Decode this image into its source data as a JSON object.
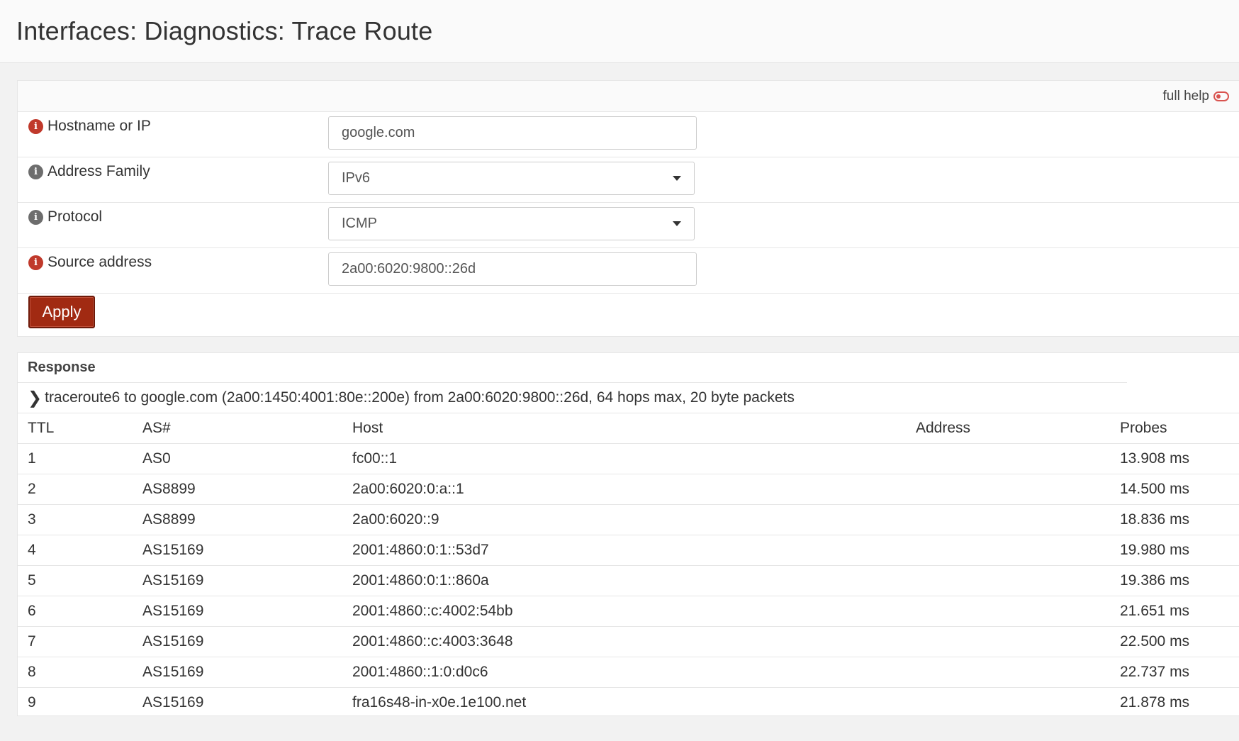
{
  "header": {
    "title": "Interfaces: Diagnostics: Trace Route"
  },
  "form": {
    "full_help_label": "full help",
    "fields": [
      {
        "label": "Hostname or IP",
        "value": "google.com",
        "info_color": "#c0392b"
      },
      {
        "label": "Address Family",
        "value": "IPv6",
        "info_color": "#6d6d6d"
      },
      {
        "label": "Protocol",
        "value": "ICMP",
        "info_color": "#6d6d6d"
      },
      {
        "label": "Source address",
        "value": "2a00:6020:9800::26d",
        "info_color": "#c0392b"
      }
    ],
    "apply_label": "Apply"
  },
  "response": {
    "title": "Response",
    "command": "traceroute6 to google.com (2a00:1450:4001:80e::200e) from 2a00:6020:9800::26d, 64 hops max, 20 byte packets",
    "columns": [
      "TTL",
      "AS#",
      "Host",
      "Address",
      "Probes"
    ],
    "rows": [
      {
        "ttl": "1",
        "as": "AS0",
        "host": "fc00::1",
        "address": "",
        "probes": "13.908 ms"
      },
      {
        "ttl": "2",
        "as": "AS8899",
        "host": "2a00:6020:0:a::1",
        "address": "",
        "probes": "14.500 ms"
      },
      {
        "ttl": "3",
        "as": "AS8899",
        "host": "2a00:6020::9",
        "address": "",
        "probes": "18.836 ms"
      },
      {
        "ttl": "4",
        "as": "AS15169",
        "host": "2001:4860:0:1::53d7",
        "address": "",
        "probes": "19.980 ms"
      },
      {
        "ttl": "5",
        "as": "AS15169",
        "host": "2001:4860:0:1::860a",
        "address": "",
        "probes": "19.386 ms"
      },
      {
        "ttl": "6",
        "as": "AS15169",
        "host": "2001:4860::c:4002:54bb",
        "address": "",
        "probes": "21.651 ms"
      },
      {
        "ttl": "7",
        "as": "AS15169",
        "host": "2001:4860::c:4003:3648",
        "address": "",
        "probes": "22.500 ms"
      },
      {
        "ttl": "8",
        "as": "AS15169",
        "host": "2001:4860::1:0:d0c6",
        "address": "",
        "probes": "22.737 ms"
      },
      {
        "ttl": "9",
        "as": "AS15169",
        "host": "fra16s48-in-x0e.1e100.net",
        "address": "",
        "probes": "21.878 ms"
      }
    ]
  }
}
